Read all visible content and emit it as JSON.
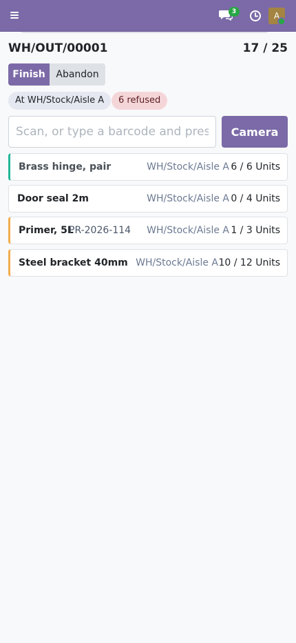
{
  "header": {
    "notification_count": "3",
    "avatar_letter": "A",
    "brand_color": "#7b6aa7"
  },
  "picking": {
    "reference": "WH/OUT/00001",
    "progress_text": "17 / 25"
  },
  "actions": {
    "finish_label": "Finish",
    "abandon_label": "Abandon"
  },
  "tags": {
    "location": "At WH/Stock/Aisle A",
    "refused": "6 refused"
  },
  "scan": {
    "placeholder": "Scan, or type a barcode and press enter",
    "camera_label": "Camera"
  },
  "lines": [
    {
      "product": "Brass hinge, pair",
      "lot": "",
      "location": "WH/Stock/Aisle A",
      "quantity": "6 / 6 Units",
      "state": "done"
    },
    {
      "product": "Door seal 2m",
      "lot": "",
      "location": "WH/Stock/Aisle A",
      "quantity": "0 / 4 Units",
      "state": "todo"
    },
    {
      "product": "Primer, 5L",
      "lot": "PR-2026-114",
      "location": "WH/Stock/Aisle A",
      "quantity": "1 / 3 Units",
      "state": "partial"
    },
    {
      "product": "Steel bracket 40mm",
      "lot": "",
      "location": "WH/Stock/Aisle A",
      "quantity": "10 / 12 Units",
      "state": "partial"
    }
  ]
}
